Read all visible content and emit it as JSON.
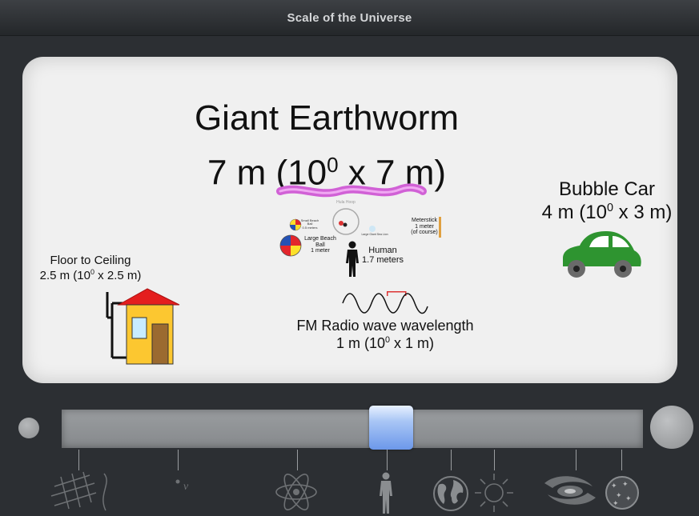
{
  "app": {
    "title": "Scale of the Universe"
  },
  "focus": {
    "name": "Giant Earthworm",
    "size_prefix": "7 m (10",
    "exponent": "0",
    "size_suffix": " x 7 m)"
  },
  "objects": {
    "floor": {
      "name": "Floor to Ceiling",
      "size_prefix": "2.5 m (10",
      "exponent": "0",
      "size_suffix": " x 2.5 m)"
    },
    "car": {
      "name": "Bubble Car",
      "size_prefix": "4 m (10",
      "exponent": "0",
      "size_suffix": " x 3 m)"
    },
    "radio": {
      "name": "FM Radio wave wavelength",
      "size_prefix": "1 m (10",
      "exponent": "0",
      "size_suffix": " x 1 m)"
    },
    "human": {
      "name": "Human",
      "size": "1.7 meters"
    },
    "beach_ball": {
      "name_line1": "Large Beach",
      "name_line2": "Ball",
      "size": "1 meter"
    },
    "small_ball": {
      "name_line1": "Small Beach",
      "name_line2": "Ball",
      "size": "0.5 meters"
    },
    "meterstick": {
      "name": "Meterstick",
      "size": "1 meter",
      "note": "(of course)"
    },
    "tiny_ring_label": "Hula Hoop",
    "tiny_creature_label": "Large Giant Sea Lion"
  },
  "colors": {
    "worm": "#d161d6",
    "car": "#2e9430",
    "house_wall": "#fcc730",
    "house_roof": "#e41e1e",
    "slider_thumb": "#8db3f0"
  },
  "navigation": {
    "zoom_out_icon": "zoom-out-circle-icon",
    "zoom_in_icon": "zoom-in-circle-icon",
    "scale_icons": [
      "strings-grid-icon",
      "neutrino-icon",
      "atom-icon",
      "human-silhouette-icon",
      "earth-icon",
      "sun-icon",
      "galaxy-icon",
      "universe-sphere-icon"
    ]
  }
}
